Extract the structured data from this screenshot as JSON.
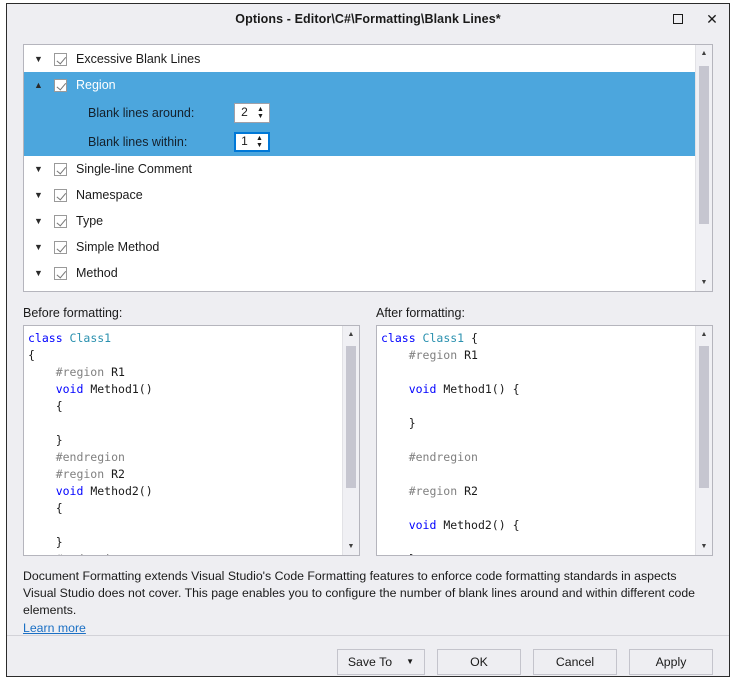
{
  "window": {
    "title": "Options - Editor\\C#\\Formatting\\Blank Lines*",
    "maximize_icon": "maximize-icon",
    "close_icon": "close-icon",
    "close_glyph": "✕"
  },
  "tree": {
    "items": [
      {
        "label": "Excessive Blank Lines",
        "expander": "▼",
        "checked": true,
        "selected": false
      },
      {
        "label": "Region",
        "expander": "▲",
        "checked": true,
        "selected": true
      },
      {
        "label": "Single-line Comment",
        "expander": "▼",
        "checked": true,
        "selected": false
      },
      {
        "label": "Namespace",
        "expander": "▼",
        "checked": true,
        "selected": false
      },
      {
        "label": "Type",
        "expander": "▼",
        "checked": true,
        "selected": false
      },
      {
        "label": "Simple Method",
        "expander": "▼",
        "checked": true,
        "selected": false
      },
      {
        "label": "Method",
        "expander": "▼",
        "checked": true,
        "selected": false
      }
    ],
    "sub_options": [
      {
        "label": "Blank lines around:",
        "value": "2",
        "focused": false
      },
      {
        "label": "Blank lines within:",
        "value": "1",
        "focused": true
      }
    ],
    "scroll_up_glyph": "▲",
    "scroll_down_glyph": "▼"
  },
  "before_pane": {
    "label": "Before formatting:",
    "lines": [
      [
        {
          "t": "class ",
          "c": "kw"
        },
        {
          "t": "Class1",
          "c": "typ"
        }
      ],
      [
        {
          "t": "{",
          "c": "pln"
        }
      ],
      [
        {
          "t": "    #region ",
          "c": "pre"
        },
        {
          "t": "R1",
          "c": "pln"
        }
      ],
      [
        {
          "t": "    ",
          "c": "pln"
        },
        {
          "t": "void ",
          "c": "kw"
        },
        {
          "t": "Method1()",
          "c": "pln"
        }
      ],
      [
        {
          "t": "    {",
          "c": "pln"
        }
      ],
      [
        {
          "t": "",
          "c": "pln"
        }
      ],
      [
        {
          "t": "    }",
          "c": "pln"
        }
      ],
      [
        {
          "t": "    #endregion",
          "c": "pre"
        }
      ],
      [
        {
          "t": "    #region ",
          "c": "pre"
        },
        {
          "t": "R2",
          "c": "pln"
        }
      ],
      [
        {
          "t": "    ",
          "c": "pln"
        },
        {
          "t": "void ",
          "c": "kw"
        },
        {
          "t": "Method2()",
          "c": "pln"
        }
      ],
      [
        {
          "t": "    {",
          "c": "pln"
        }
      ],
      [
        {
          "t": "",
          "c": "pln"
        }
      ],
      [
        {
          "t": "    }",
          "c": "pln"
        }
      ],
      [
        {
          "t": "    #endregion",
          "c": "pre"
        }
      ],
      [
        {
          "t": "}",
          "c": "pln"
        }
      ]
    ]
  },
  "after_pane": {
    "label": "After formatting:",
    "lines": [
      [
        {
          "t": "class ",
          "c": "kw"
        },
        {
          "t": "Class1",
          "c": "typ"
        },
        {
          "t": " {",
          "c": "pln"
        }
      ],
      [
        {
          "t": "    #region ",
          "c": "pre"
        },
        {
          "t": "R1",
          "c": "pln"
        }
      ],
      [
        {
          "t": "",
          "c": "pln"
        }
      ],
      [
        {
          "t": "    ",
          "c": "pln"
        },
        {
          "t": "void ",
          "c": "kw"
        },
        {
          "t": "Method1() {",
          "c": "pln"
        }
      ],
      [
        {
          "t": "",
          "c": "pln"
        }
      ],
      [
        {
          "t": "    }",
          "c": "pln"
        }
      ],
      [
        {
          "t": "",
          "c": "pln"
        }
      ],
      [
        {
          "t": "    #endregion",
          "c": "pre"
        }
      ],
      [
        {
          "t": "",
          "c": "pln"
        }
      ],
      [
        {
          "t": "    #region ",
          "c": "pre"
        },
        {
          "t": "R2",
          "c": "pln"
        }
      ],
      [
        {
          "t": "",
          "c": "pln"
        }
      ],
      [
        {
          "t": "    ",
          "c": "pln"
        },
        {
          "t": "void ",
          "c": "kw"
        },
        {
          "t": "Method2() {",
          "c": "pln"
        }
      ],
      [
        {
          "t": "",
          "c": "pln"
        }
      ],
      [
        {
          "t": "    }",
          "c": "pln"
        }
      ]
    ]
  },
  "description": {
    "text": "Document Formatting extends Visual Studio's Code Formatting features to enforce code formatting standards in aspects Visual Studio does not cover. This page enables you to configure the number of blank lines around and within different code elements.",
    "link": "Learn more"
  },
  "footer": {
    "save_to": "Save To",
    "save_to_caret": "▼",
    "ok": "OK",
    "cancel": "Cancel",
    "apply": "Apply"
  },
  "colors": {
    "selection_blue": "#4ca6dd",
    "focus_blue": "#0078d7",
    "link_blue": "#1a6fc4",
    "keyword": "#0000ff",
    "type": "#2b91af",
    "preprocessor": "#808080",
    "dialog_bg": "#eeeef2"
  }
}
